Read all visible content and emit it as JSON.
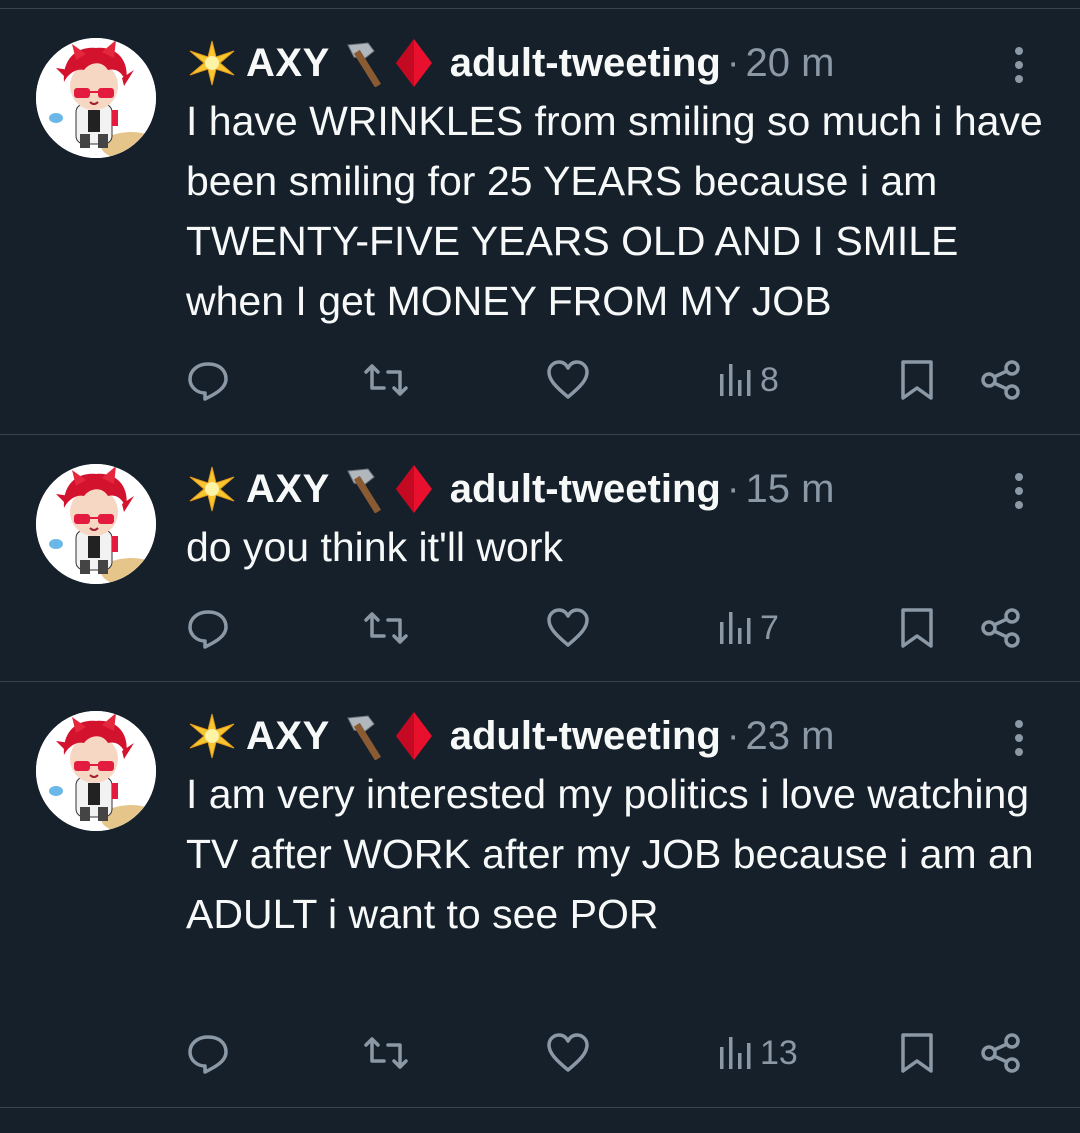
{
  "colors": {
    "background": "#15202b",
    "divider": "#38444d",
    "text": "#f7f9f9",
    "muted": "#8b98a5"
  },
  "icons": {
    "avatar": "avatar-plush-red-hair",
    "sparkle": "glowing-star-emoji",
    "axe": "axe-emoji",
    "diamond": "red-diamond-emoji",
    "reply": "reply-icon",
    "retweet": "retweet-icon",
    "like": "like-icon",
    "views": "views-icon",
    "bookmark": "bookmark-icon",
    "share": "share-icon",
    "more": "more-icon"
  },
  "tweets": [
    {
      "name": "AXY",
      "handle": "adult-tweeting",
      "separator": "·",
      "time": "20 m",
      "text": "I have WRINKLES from smiling so much i have been smiling for 25 YEARS because i am TWENTY-FIVE YEARS OLD AND I SMILE when I get MONEY FROM MY JOB",
      "views": "8"
    },
    {
      "name": "AXY",
      "handle": "adult-tweeting",
      "separator": "·",
      "time": "15 m",
      "text": "do you think it'll work",
      "views": "7"
    },
    {
      "name": "AXY",
      "handle": "adult-tweeting",
      "separator": "·",
      "time": "23 m",
      "text": "I am very interested my politics i love watching TV after WORK after my JOB because i am an ADULT i want to see POR",
      "views": "13"
    }
  ]
}
